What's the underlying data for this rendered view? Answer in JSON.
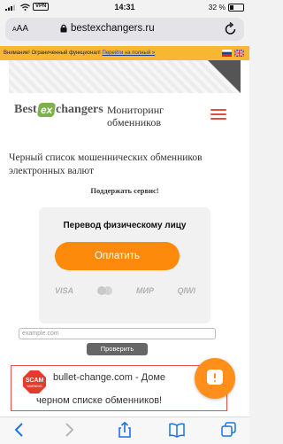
{
  "status_bar": {
    "vpn": "VPN",
    "time": "14:31",
    "battery": "32 %",
    "battery_level": 0.32
  },
  "browser": {
    "text_size_label": "AA",
    "url": "bestexchangers.ru"
  },
  "notice": {
    "text": "Внимание! Ограниченный функционал!",
    "link": "Перейти на полный »",
    "languages": [
      "ru",
      "en"
    ]
  },
  "header": {
    "logo": {
      "part1": "Best",
      "part2": "ex",
      "part3": "changers"
    },
    "tagline_line1": "Мониторинг",
    "tagline_line2": "обменников"
  },
  "main": {
    "heading_line1": "Черный список мошеннических обменников",
    "heading_line2": "электронных валют",
    "support_text": "Поддержать сервис!"
  },
  "donation": {
    "title": "Перевод физическому лицу",
    "pay_label": "Оплатить",
    "methods": [
      "VISA",
      "mastercard",
      "МИР",
      "QIWI"
    ]
  },
  "check_form": {
    "placeholder": "example.com",
    "button_label": "Проверить"
  },
  "scam_banner": {
    "badge_top": "SCAM",
    "badge_bottom": "WARNING",
    "line1": "bullet-change.com - Доме",
    "line2": "черном списке обменников!"
  },
  "colors": {
    "accent_orange": "#fe8a0c",
    "warning_yellow": "#f7b733",
    "logo_green": "#7db14a",
    "menu_red": "#e74c3c",
    "scam_red": "#e35050"
  }
}
